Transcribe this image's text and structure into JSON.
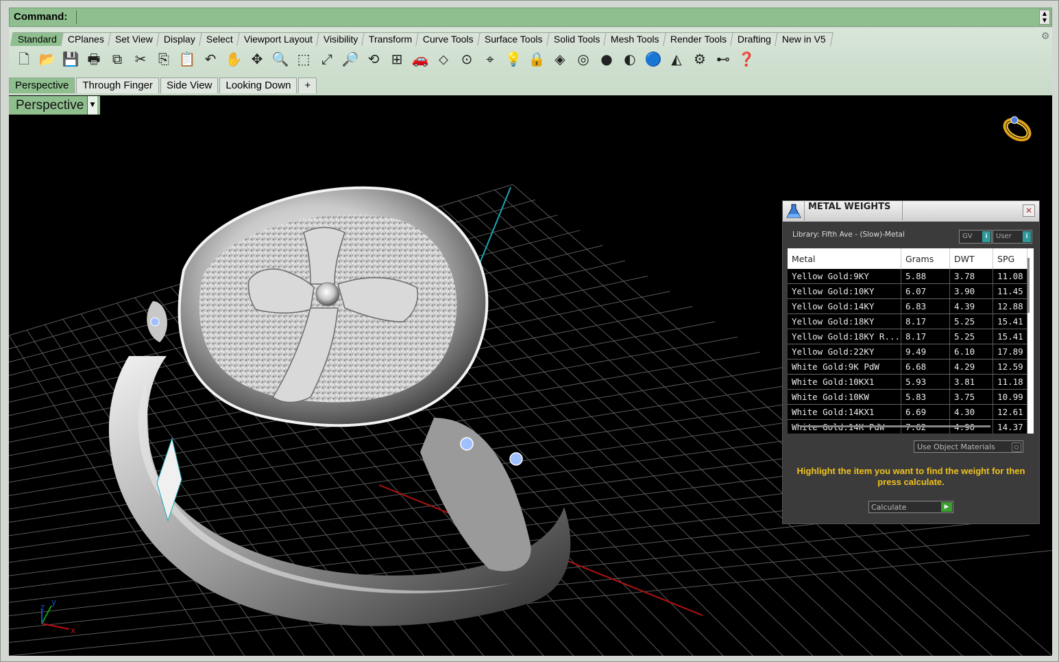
{
  "command": {
    "label": "Command:",
    "value": ""
  },
  "toolbar_tabs": [
    {
      "label": "Standard",
      "active": true
    },
    {
      "label": "CPlanes"
    },
    {
      "label": "Set View"
    },
    {
      "label": "Display"
    },
    {
      "label": "Select"
    },
    {
      "label": "Viewport Layout"
    },
    {
      "label": "Visibility"
    },
    {
      "label": "Transform"
    },
    {
      "label": "Curve Tools"
    },
    {
      "label": "Surface Tools"
    },
    {
      "label": "Solid Tools"
    },
    {
      "label": "Mesh Tools"
    },
    {
      "label": "Render Tools"
    },
    {
      "label": "Drafting"
    },
    {
      "label": "New in V5"
    }
  ],
  "toolbar_icons": [
    {
      "name": "new-icon",
      "glyph": "🗋"
    },
    {
      "name": "open-icon",
      "glyph": "📂"
    },
    {
      "name": "save-icon",
      "glyph": "💾"
    },
    {
      "name": "print-icon",
      "glyph": "🖶"
    },
    {
      "name": "export-icon",
      "glyph": "⧉"
    },
    {
      "name": "cut-icon",
      "glyph": "✂"
    },
    {
      "name": "copy-icon",
      "glyph": "⎘"
    },
    {
      "name": "paste-icon",
      "glyph": "📋"
    },
    {
      "name": "undo-icon",
      "glyph": "↶"
    },
    {
      "name": "pan-icon",
      "glyph": "✋"
    },
    {
      "name": "move-view-icon",
      "glyph": "✥"
    },
    {
      "name": "zoom-icon",
      "glyph": "🔍"
    },
    {
      "name": "zoom-window-icon",
      "glyph": "⬚"
    },
    {
      "name": "zoom-extents-icon",
      "glyph": "⤢"
    },
    {
      "name": "zoom-selected-icon",
      "glyph": "🔎"
    },
    {
      "name": "rotate-view-icon",
      "glyph": "⟲"
    },
    {
      "name": "viewport-grid-icon",
      "glyph": "⊞"
    },
    {
      "name": "car-icon",
      "glyph": "🚗"
    },
    {
      "name": "cplane-icon",
      "glyph": "⬦"
    },
    {
      "name": "point-icon",
      "glyph": "⊙"
    },
    {
      "name": "osnap-icon",
      "glyph": "⌖"
    },
    {
      "name": "light-icon",
      "glyph": "💡"
    },
    {
      "name": "lock-icon",
      "glyph": "🔒"
    },
    {
      "name": "layer-icon",
      "glyph": "◈"
    },
    {
      "name": "color-wheel-icon",
      "glyph": "◎"
    },
    {
      "name": "shaded-sphere-icon",
      "glyph": "●"
    },
    {
      "name": "rendered-sphere-icon",
      "glyph": "◐"
    },
    {
      "name": "blue-sphere-icon",
      "glyph": "🔵"
    },
    {
      "name": "material-icon",
      "glyph": "◭"
    },
    {
      "name": "settings-icon",
      "glyph": "⚙"
    },
    {
      "name": "dimension-icon",
      "glyph": "⊷"
    },
    {
      "name": "help-icon",
      "glyph": "❓"
    }
  ],
  "viewport_tabs": [
    {
      "label": "Perspective",
      "active": true
    },
    {
      "label": "Through Finger"
    },
    {
      "label": "Side View"
    },
    {
      "label": "Looking Down"
    },
    {
      "label": "+"
    }
  ],
  "viewport": {
    "title": "Perspective"
  },
  "axis_labels": {
    "x": "x",
    "y": "y",
    "z": "z"
  },
  "panel": {
    "title": "METAL WEIGHTS",
    "library": "Library: Fifth Ave - (Slow)-Metal",
    "chip_gv": "GV",
    "chip_user": "User",
    "columns": [
      "Metal",
      "Grams",
      "DWT",
      "SPG"
    ],
    "rows": [
      [
        "Yellow Gold:9KY",
        "5.88",
        "3.78",
        "11.08"
      ],
      [
        "Yellow Gold:10KY",
        "6.07",
        "3.90",
        "11.45"
      ],
      [
        "Yellow Gold:14KY",
        "6.83",
        "4.39",
        "12.88"
      ],
      [
        "Yellow Gold:18KY",
        "8.17",
        "5.25",
        "15.41"
      ],
      [
        "Yellow Gold:18KY R...",
        "8.17",
        "5.25",
        "15.41"
      ],
      [
        "Yellow Gold:22KY",
        "9.49",
        "6.10",
        "17.89"
      ],
      [
        "White Gold:9K PdW",
        "6.68",
        "4.29",
        "12.59"
      ],
      [
        "White Gold:10KX1",
        "5.93",
        "3.81",
        "11.18"
      ],
      [
        "White Gold:10KW",
        "5.83",
        "3.75",
        "10.99"
      ],
      [
        "White Gold:14KX1",
        "6.69",
        "4.30",
        "12.61"
      ],
      [
        "White Gold:14K PdW",
        "7.62",
        "4.90",
        "14.37"
      ]
    ],
    "use_materials": "Use Object Materials",
    "hint": "Highlight the item you want to find the weight for then press calculate.",
    "calculate": "Calculate"
  }
}
